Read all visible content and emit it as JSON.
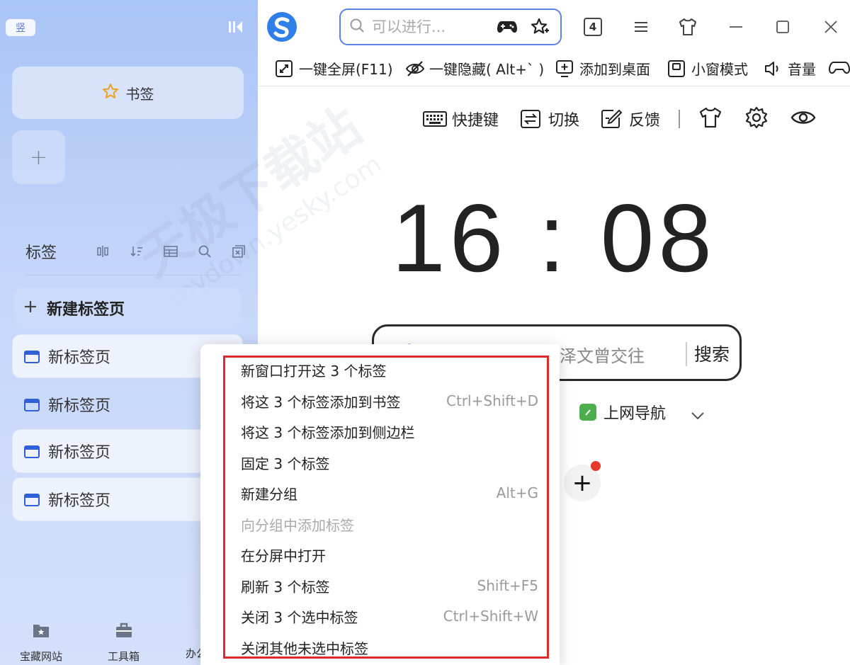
{
  "sidebar": {
    "mode_badge": "竖",
    "bookmark_label": "书签",
    "add_label": "+",
    "tabs_title": "标签",
    "new_tab_label": "新建标签页",
    "tabs": [
      {
        "label": "新标签页"
      },
      {
        "label": "新标签页"
      },
      {
        "label": "新标签页"
      },
      {
        "label": "新标签页"
      }
    ],
    "bottom": {
      "treasure": "宝藏网站",
      "toolbox": "工具箱",
      "office_partial": "办公"
    }
  },
  "topbar": {
    "search_placeholder": "可以进行...",
    "tab_count": "4"
  },
  "quickbar": {
    "fullscreen": "一键全屏(F11)",
    "hide": "一键隐藏( Alt+` )",
    "add_desktop": "添加到桌面",
    "mini_window": "小窗模式",
    "volume": "音量"
  },
  "main": {
    "tools": {
      "shortcuts": "快捷键",
      "switch": "切换",
      "feedback": "反馈"
    },
    "clock": "16 : 08",
    "search_text": "泽文曾交往",
    "search_button": "搜索",
    "nav_label": "上网导航",
    "add_site": "+"
  },
  "context_menu": [
    {
      "label": "新窗口打开这 3 个标签",
      "shortcut": "",
      "disabled": false
    },
    {
      "label": "将这 3 个标签添加到书签",
      "shortcut": "Ctrl+Shift+D",
      "disabled": false
    },
    {
      "label": "将这 3 个标签添加到侧边栏",
      "shortcut": "",
      "disabled": false
    },
    {
      "label": "固定 3 个标签",
      "shortcut": "",
      "disabled": false
    },
    {
      "label": "新建分组",
      "shortcut": "Alt+G",
      "disabled": false
    },
    {
      "label": "向分组中添加标签",
      "shortcut": "",
      "disabled": true
    },
    {
      "label": "在分屏中打开",
      "shortcut": "",
      "disabled": false
    },
    {
      "label": "刷新 3 个标签",
      "shortcut": "Shift+F5",
      "disabled": false
    },
    {
      "label": "关闭 3 个选中标签",
      "shortcut": "Ctrl+Shift+W",
      "disabled": false
    },
    {
      "label": "关闭其他未选中标签",
      "shortcut": "",
      "disabled": false
    }
  ],
  "watermark": {
    "cn": "天极下载站",
    "en": "mydown.yesky.com"
  },
  "colors": {
    "accent": "#5b82f0",
    "highlight": "#e0292b",
    "tab_icon": "#2f5fd9",
    "nav_icon": "#4cae4c"
  }
}
